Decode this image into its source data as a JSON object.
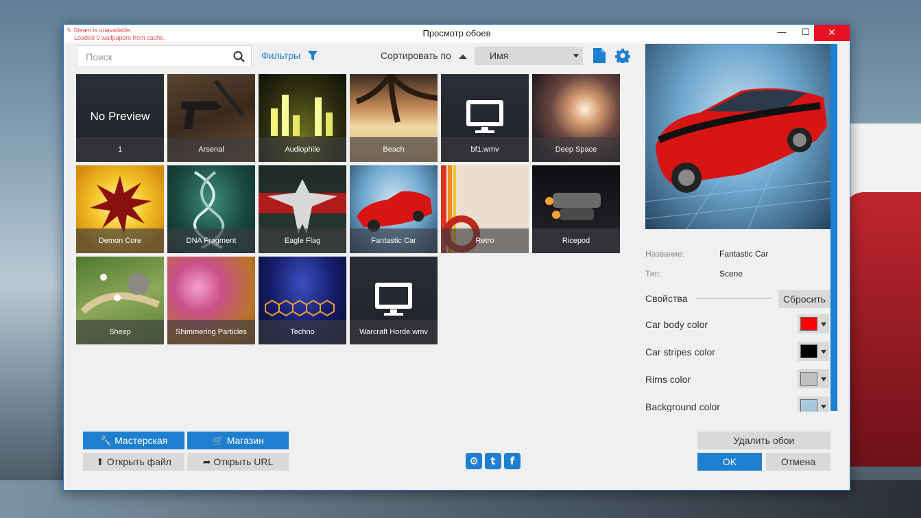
{
  "window": {
    "title": "Просмотр обоев",
    "steam_warning_line1": "Steam is unavailable.",
    "steam_warning_line2": "Loaded 0 wallpapers from cache.",
    "min_label": "🗕",
    "max_label": "☐",
    "close_label": "✕"
  },
  "toolbar": {
    "search_placeholder": "Поиск",
    "filters_label": "Фильтры",
    "sort_label": "Сортировать по",
    "sort_value": "Имя"
  },
  "wallpapers": [
    {
      "name": "1",
      "no_preview_text": "No Preview"
    },
    {
      "name": "Arsenal"
    },
    {
      "name": "Audiophile"
    },
    {
      "name": "Beach"
    },
    {
      "name": "bf1.wmv"
    },
    {
      "name": "Deep Space"
    },
    {
      "name": "Demon Core"
    },
    {
      "name": "DNA Fragment"
    },
    {
      "name": "Eagle Flag"
    },
    {
      "name": "Fantastic Car",
      "selected": true
    },
    {
      "name": "Retro"
    },
    {
      "name": "Ricepod"
    },
    {
      "name": "Sheep"
    },
    {
      "name": "Shimmering Particles"
    },
    {
      "name": "Techno"
    },
    {
      "name": "Warcraft Horde.wmv"
    }
  ],
  "details": {
    "name_label": "Название:",
    "name_value": "Fantastic Car",
    "type_label": "Тип:",
    "type_value": "Scene",
    "properties_label": "Свойства",
    "reset_label": "Сбросить",
    "properties": [
      {
        "label": "Car body color",
        "color": "#ff0000"
      },
      {
        "label": "Car stripes color",
        "color": "#000000"
      },
      {
        "label": "Rims color",
        "color": "#c0c0c0"
      },
      {
        "label": "Background color",
        "color": "#a9c8de"
      }
    ]
  },
  "bottom": {
    "workshop_label": "Мастерская",
    "store_label": "Магазин",
    "open_file_label": "Открыть файл",
    "open_url_label": "Открыть URL",
    "delete_label": "Удалить обои",
    "ok_label": "OK",
    "cancel_label": "Отмена"
  },
  "colors": {
    "accent": "#1e7fd0",
    "close_red": "#e81123"
  }
}
